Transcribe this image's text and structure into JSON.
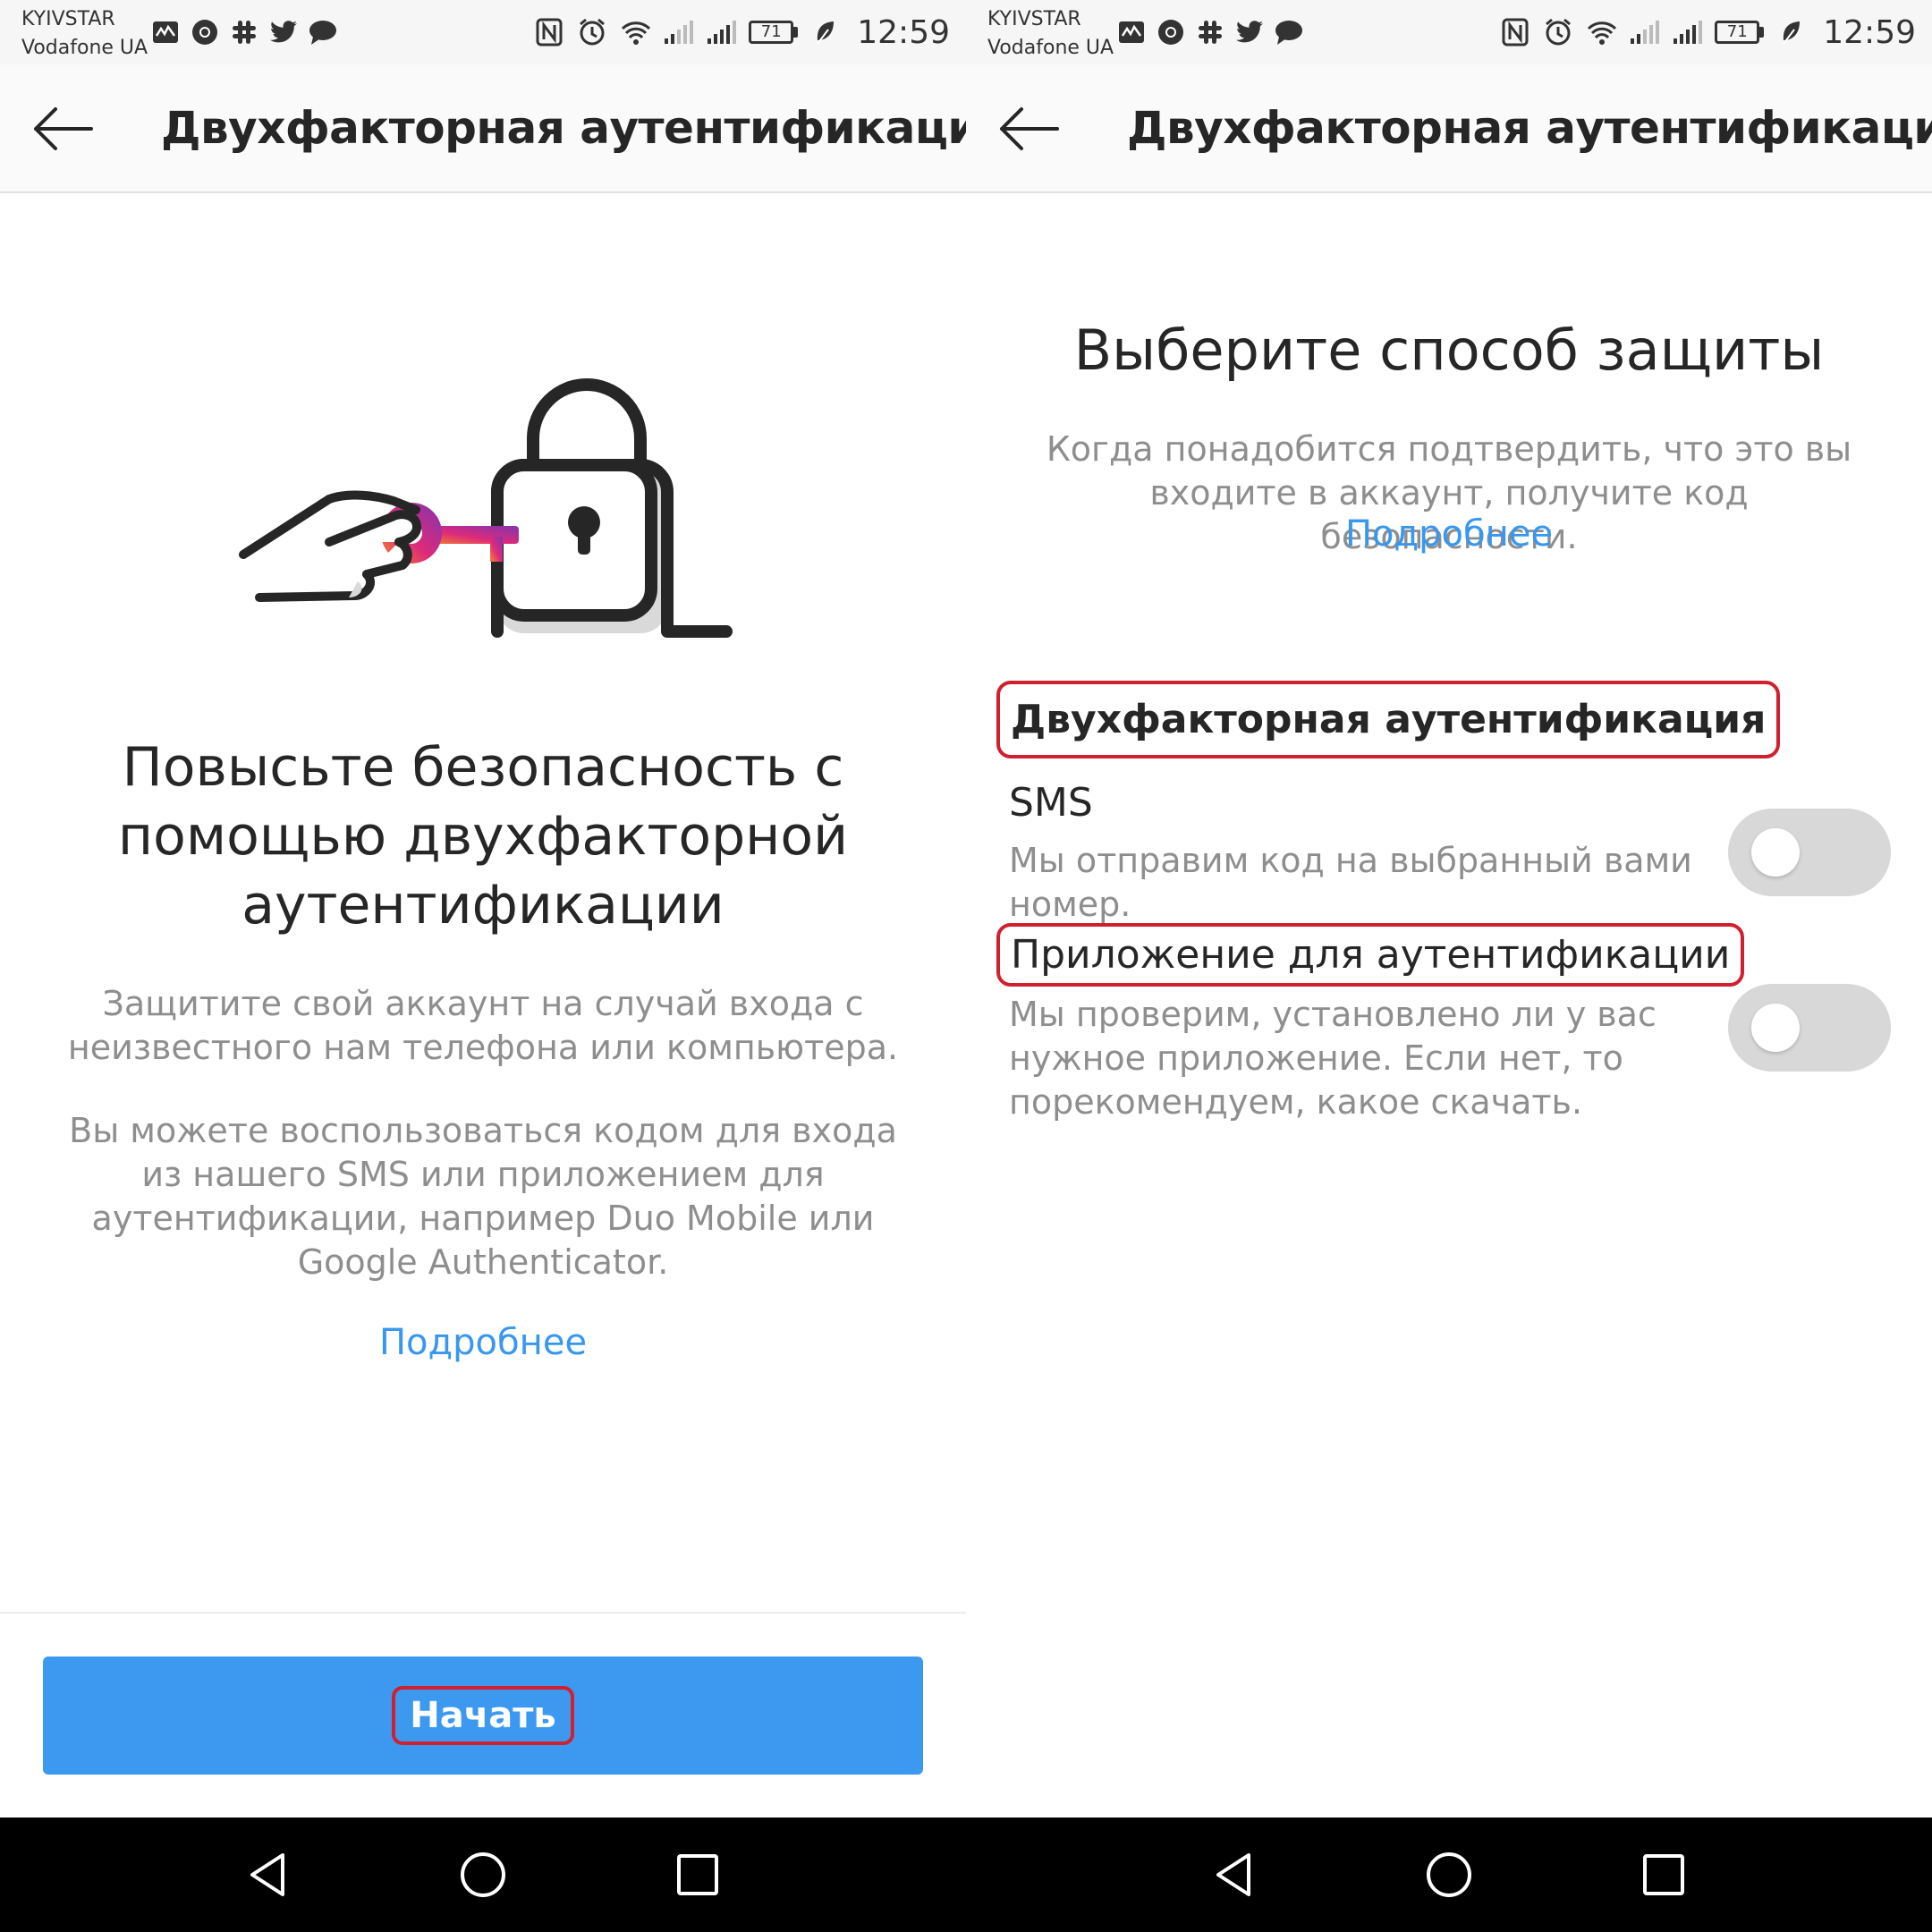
{
  "status_bar": {
    "carrier_1": "KYIVSTAR",
    "carrier_2": "Vodafone UA",
    "battery": "71",
    "time": "12:59"
  },
  "app_bar": {
    "title": "Двухфакторная аутентификация"
  },
  "intro_screen": {
    "heading": "Повысьте безопасность с помощью двухфакторной аутентификации",
    "paragraph_1": "Защитите свой аккаунт на случай входа с неизвестного нам телефона или компьютера.",
    "paragraph_2": "Вы можете воспользоваться кодом для входа из нашего SMS или приложением для аутентификации, например Duo Mobile или Google Authenticator.",
    "learn_more": "Подробнее",
    "start_button": "Начать"
  },
  "method_screen": {
    "heading": "Выберите способ защиты",
    "description": "Когда понадобится подтвердить, что это вы входите в аккаунт, получите код безопасности.",
    "learn_more": "Подробнее",
    "section_title": "Двухфакторная аутентификация",
    "options": [
      {
        "title": "SMS",
        "description": "Мы отправим код на выбранный вами номер.",
        "enabled": false
      },
      {
        "title": "Приложение для аутентификации",
        "description": "Мы проверим, установлено ли у вас нужное приложение. Если нет, то порекомендуем, какое скачать.",
        "enabled": false
      }
    ]
  },
  "colors": {
    "accent": "#3897f0",
    "button": "#3d99f0",
    "highlight": "#d0202f",
    "toggle_off": "#d8d8d8"
  },
  "icons": {
    "status_left": [
      "activity-icon",
      "chrome-icon",
      "slack-icon",
      "twitter-icon",
      "chat-icon"
    ],
    "status_right": [
      "nfc-icon",
      "alarm-icon",
      "wifi-icon",
      "signal-icon",
      "signal-icon",
      "battery-icon",
      "leaf-icon"
    ],
    "nav": [
      "back-triangle-icon",
      "home-circle-icon",
      "recents-square-icon"
    ]
  }
}
